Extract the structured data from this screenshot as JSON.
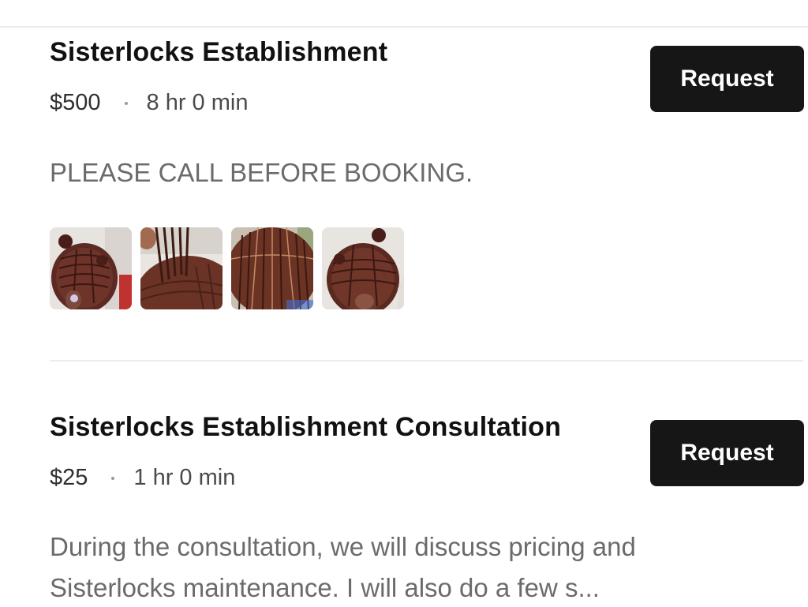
{
  "services": [
    {
      "title": "Sisterlocks Establishment",
      "price": "$500",
      "duration": "8 hr 0 min",
      "request_label": "Request",
      "description": "PLEASE CALL BEFORE BOOKING.",
      "photos": [
        "hair-photo-1",
        "hair-photo-2",
        "hair-photo-3",
        "hair-photo-4"
      ]
    },
    {
      "title": "Sisterlocks Establishment Consultation",
      "price": "$25",
      "duration": "1 hr 0 min",
      "request_label": "Request",
      "description_line1": "During the consultation, we will discuss pricing and",
      "description_line2": "Sisterlocks maintenance. I will also do a few s..."
    }
  ],
  "colors": {
    "button_bg": "#161616",
    "button_text": "#ffffff",
    "title_text": "#111111",
    "meta_text": "#3a3a3a",
    "description_text": "#6b6b6b",
    "divider": "#ececec"
  }
}
